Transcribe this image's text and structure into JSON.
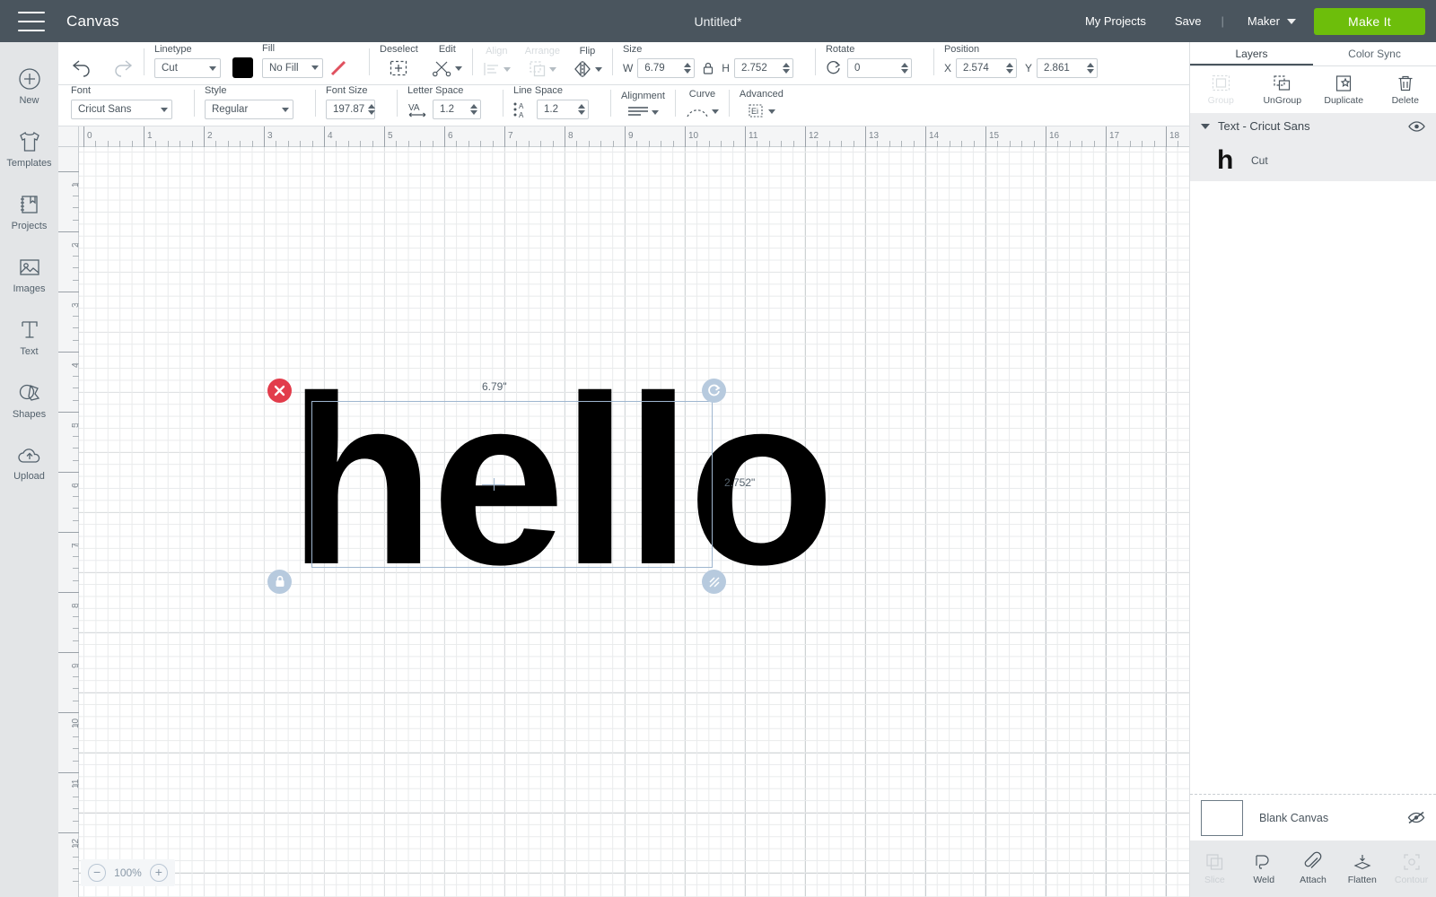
{
  "header": {
    "menu_icon": "hamburger-icon",
    "canvas_label": "Canvas",
    "doc_title": "Untitled*",
    "my_projects": "My Projects",
    "save": "Save",
    "divider": "|",
    "machine": "Maker",
    "make_it": "Make It",
    "accent_green": "#6dbe0b",
    "header_bg": "#4a555e"
  },
  "rail": {
    "items": [
      {
        "label": "New",
        "icon": "plus-circle-icon"
      },
      {
        "label": "Templates",
        "icon": "tshirt-icon"
      },
      {
        "label": "Projects",
        "icon": "book-icon"
      },
      {
        "label": "Images",
        "icon": "picture-icon"
      },
      {
        "label": "Text",
        "icon": "text-t-icon"
      },
      {
        "label": "Shapes",
        "icon": "shapes-icon"
      },
      {
        "label": "Upload",
        "icon": "upload-cloud-icon"
      }
    ]
  },
  "toolbar1": {
    "undo": "undo-icon",
    "redo": "redo-icon",
    "linetype": {
      "caption": "Linetype",
      "value": "Cut"
    },
    "fill": {
      "caption": "Fill",
      "value": "No Fill",
      "swatch_color": "#000000"
    },
    "deselect": {
      "caption": "Deselect"
    },
    "edit": {
      "caption": "Edit"
    },
    "align": {
      "caption": "Align",
      "disabled": true
    },
    "arrange": {
      "caption": "Arrange",
      "disabled": true
    },
    "flip": {
      "caption": "Flip"
    },
    "size": {
      "caption": "Size",
      "w_label": "W",
      "w_value": "6.79",
      "h_label": "H",
      "h_value": "2.752"
    },
    "rotate": {
      "caption": "Rotate",
      "value": "0"
    },
    "position": {
      "caption": "Position",
      "x_label": "X",
      "x_value": "2.574",
      "y_label": "Y",
      "y_value": "2.861"
    }
  },
  "toolbar2": {
    "font": {
      "caption": "Font",
      "value": "Cricut Sans"
    },
    "style": {
      "caption": "Style",
      "value": "Regular"
    },
    "font_size": {
      "caption": "Font Size",
      "value": "197.87"
    },
    "letter_space": {
      "caption": "Letter Space",
      "value": "1.2"
    },
    "line_space": {
      "caption": "Line Space",
      "value": "1.2"
    },
    "alignment": {
      "caption": "Alignment"
    },
    "curve": {
      "caption": "Curve"
    },
    "advanced": {
      "caption": "Advanced"
    }
  },
  "canvas": {
    "text_object": "hello",
    "width_label": "6.79\"",
    "height_label": "2.752\"",
    "zoom_level": "100%",
    "zoom_out": "−",
    "zoom_in": "+",
    "ruler_h": [
      "0",
      "1",
      "2",
      "3",
      "4",
      "5",
      "6",
      "7",
      "8",
      "9",
      "10",
      "11",
      "12",
      "13",
      "14",
      "15",
      "16",
      "17",
      "18"
    ],
    "ruler_v": [
      "1",
      "2",
      "3",
      "4",
      "5",
      "6",
      "7",
      "8",
      "9",
      "10",
      "11",
      "12"
    ],
    "handles": {
      "delete": "close-x-icon",
      "rotate": "rotate-icon",
      "lock": "lock-icon",
      "resize": "resize-handle-icon"
    }
  },
  "panel": {
    "tabs": [
      {
        "label": "Layers",
        "active": true
      },
      {
        "label": "Color Sync",
        "active": false
      }
    ],
    "actions": [
      {
        "label": "Group",
        "icon": "group-icon",
        "disabled": true
      },
      {
        "label": "UnGroup",
        "icon": "ungroup-icon",
        "disabled": false
      },
      {
        "label": "Duplicate",
        "icon": "duplicate-icon",
        "disabled": false
      },
      {
        "label": "Delete",
        "icon": "trash-icon",
        "disabled": false
      }
    ],
    "layer_group": {
      "title": "Text - Cricut Sans",
      "visibility_icon": "eye-icon",
      "rows": [
        {
          "thumb": "h",
          "type": "Cut"
        }
      ]
    },
    "canvas_row": {
      "label": "Blank Canvas",
      "visibility_icon": "eye-off-icon"
    },
    "ops": [
      {
        "label": "Slice",
        "icon": "slice-icon",
        "disabled": true
      },
      {
        "label": "Weld",
        "icon": "weld-icon",
        "disabled": false
      },
      {
        "label": "Attach",
        "icon": "paperclip-icon",
        "disabled": false
      },
      {
        "label": "Flatten",
        "icon": "flatten-icon",
        "disabled": false
      },
      {
        "label": "Contour",
        "icon": "contour-icon",
        "disabled": true
      }
    ]
  }
}
